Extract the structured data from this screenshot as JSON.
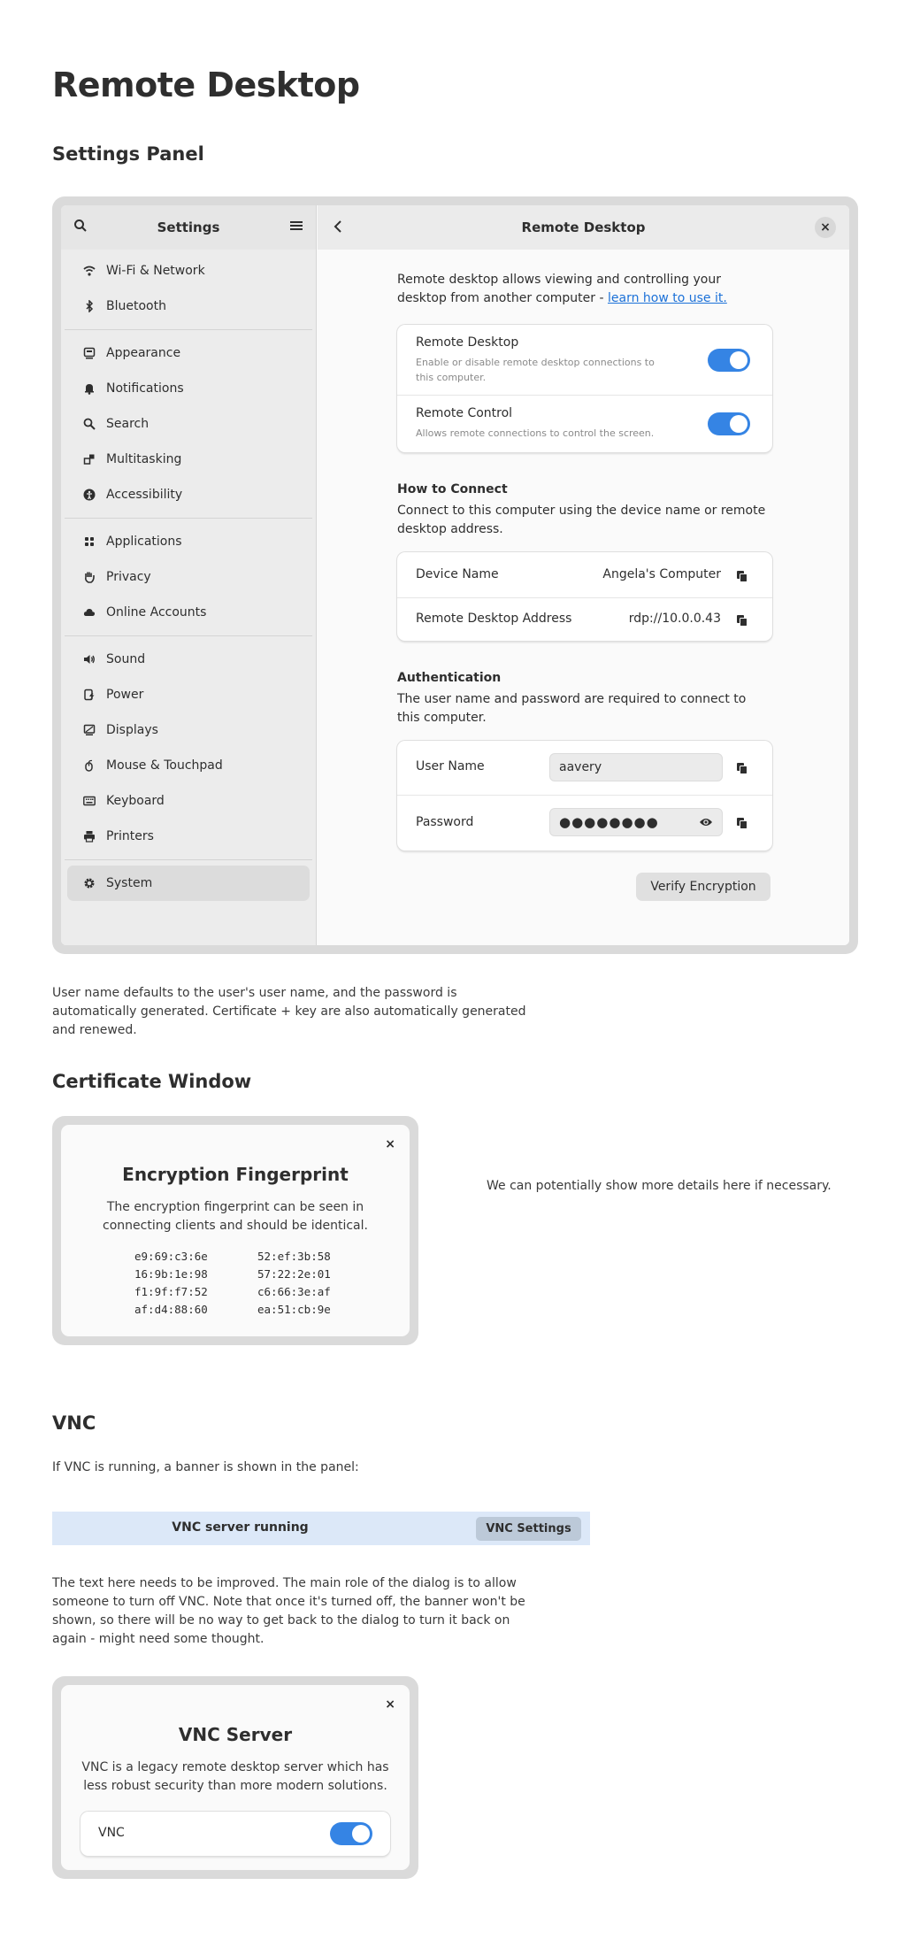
{
  "page": {
    "title": "Remote Desktop",
    "settings_heading": "Settings Panel",
    "settings_note": "User name defaults to the user's user name, and the password is automatically generated. Certificate + key are also automatically generated and renewed.",
    "certificate_heading": "Certificate Window",
    "certificate_note": "We can potentially show more details here if necessary.",
    "vnc_heading": "VNC",
    "vnc_intro": "If VNC is running, a banner is shown in the panel:",
    "vnc_note": "The text here needs to be improved. The main role of the dialog is to allow someone to turn off VNC. Note that once it's turned off, the banner won't be shown, so there will be no way to get back to the dialog to turn it back on again - might need some thought."
  },
  "sidebar": {
    "title": "Settings",
    "groups": [
      [
        {
          "label": "Wi-Fi & Network",
          "icon": "wifi-icon"
        },
        {
          "label": "Bluetooth",
          "icon": "bluetooth-icon"
        }
      ],
      [
        {
          "label": "Appearance",
          "icon": "appearance-icon"
        },
        {
          "label": "Notifications",
          "icon": "bell-icon"
        },
        {
          "label": "Search",
          "icon": "search-icon"
        },
        {
          "label": "Multitasking",
          "icon": "multitasking-icon"
        },
        {
          "label": "Accessibility",
          "icon": "accessibility-icon"
        }
      ],
      [
        {
          "label": "Applications",
          "icon": "apps-grid-icon"
        },
        {
          "label": "Privacy",
          "icon": "hand-icon"
        },
        {
          "label": "Online Accounts",
          "icon": "cloud-icon"
        }
      ],
      [
        {
          "label": "Sound",
          "icon": "speaker-icon"
        },
        {
          "label": "Power",
          "icon": "power-icon"
        },
        {
          "label": "Displays",
          "icon": "display-icon"
        },
        {
          "label": "Mouse & Touchpad",
          "icon": "mouse-icon"
        },
        {
          "label": "Keyboard",
          "icon": "keyboard-icon"
        },
        {
          "label": "Printers",
          "icon": "printer-icon"
        }
      ],
      [
        {
          "label": "System",
          "icon": "gear-icon",
          "active": true
        }
      ]
    ]
  },
  "panel": {
    "title": "Remote Desktop",
    "intro": "Remote desktop allows viewing and controlling your desktop from another computer - ",
    "intro_link": "learn how to use it.",
    "remote_desktop": {
      "title": "Remote Desktop",
      "subtitle": "Enable or disable remote desktop connections to this computer.",
      "enabled": true
    },
    "remote_control": {
      "title": "Remote Control",
      "subtitle": "Allows remote connections to control the screen.",
      "enabled": true
    },
    "how_to_connect": {
      "title": "How to Connect",
      "description": "Connect to this computer using the device name or remote desktop address.",
      "device_name_label": "Device Name",
      "device_name_value": "Angela's Computer",
      "address_label": "Remote Desktop Address",
      "address_value": "rdp://10.0.0.43"
    },
    "authentication": {
      "title": "Authentication",
      "description": "The user name and password are required to connect to this computer.",
      "username_label": "User Name",
      "username_value": "aavery",
      "password_label": "Password",
      "password_value": "●●●●●●●●"
    },
    "verify_button": "Verify Encryption"
  },
  "fingerprint_dialog": {
    "title": "Encryption Fingerprint",
    "text": "The encryption fingerprint can be seen in connecting clients and should be identical.",
    "left": [
      "e9:69:c3:6e",
      "16:9b:1e:98",
      "f1:9f:f7:52",
      "af:d4:88:60"
    ],
    "right": [
      "52:ef:3b:58",
      "57:22:2e:01",
      "c6:66:3e:af",
      "ea:51:cb:9e"
    ],
    "close": "×"
  },
  "vnc_banner": {
    "text": "VNC server running",
    "button": "VNC Settings"
  },
  "vnc_dialog": {
    "title": "VNC Server",
    "text": "VNC is a legacy remote desktop server which has less robust security than more modern solutions.",
    "row_label": "VNC",
    "enabled": true,
    "close": "×"
  },
  "colors": {
    "accent": "#3584e4",
    "link": "#1c71d8",
    "banner": "#dce8f8",
    "frame": "#dadada"
  }
}
